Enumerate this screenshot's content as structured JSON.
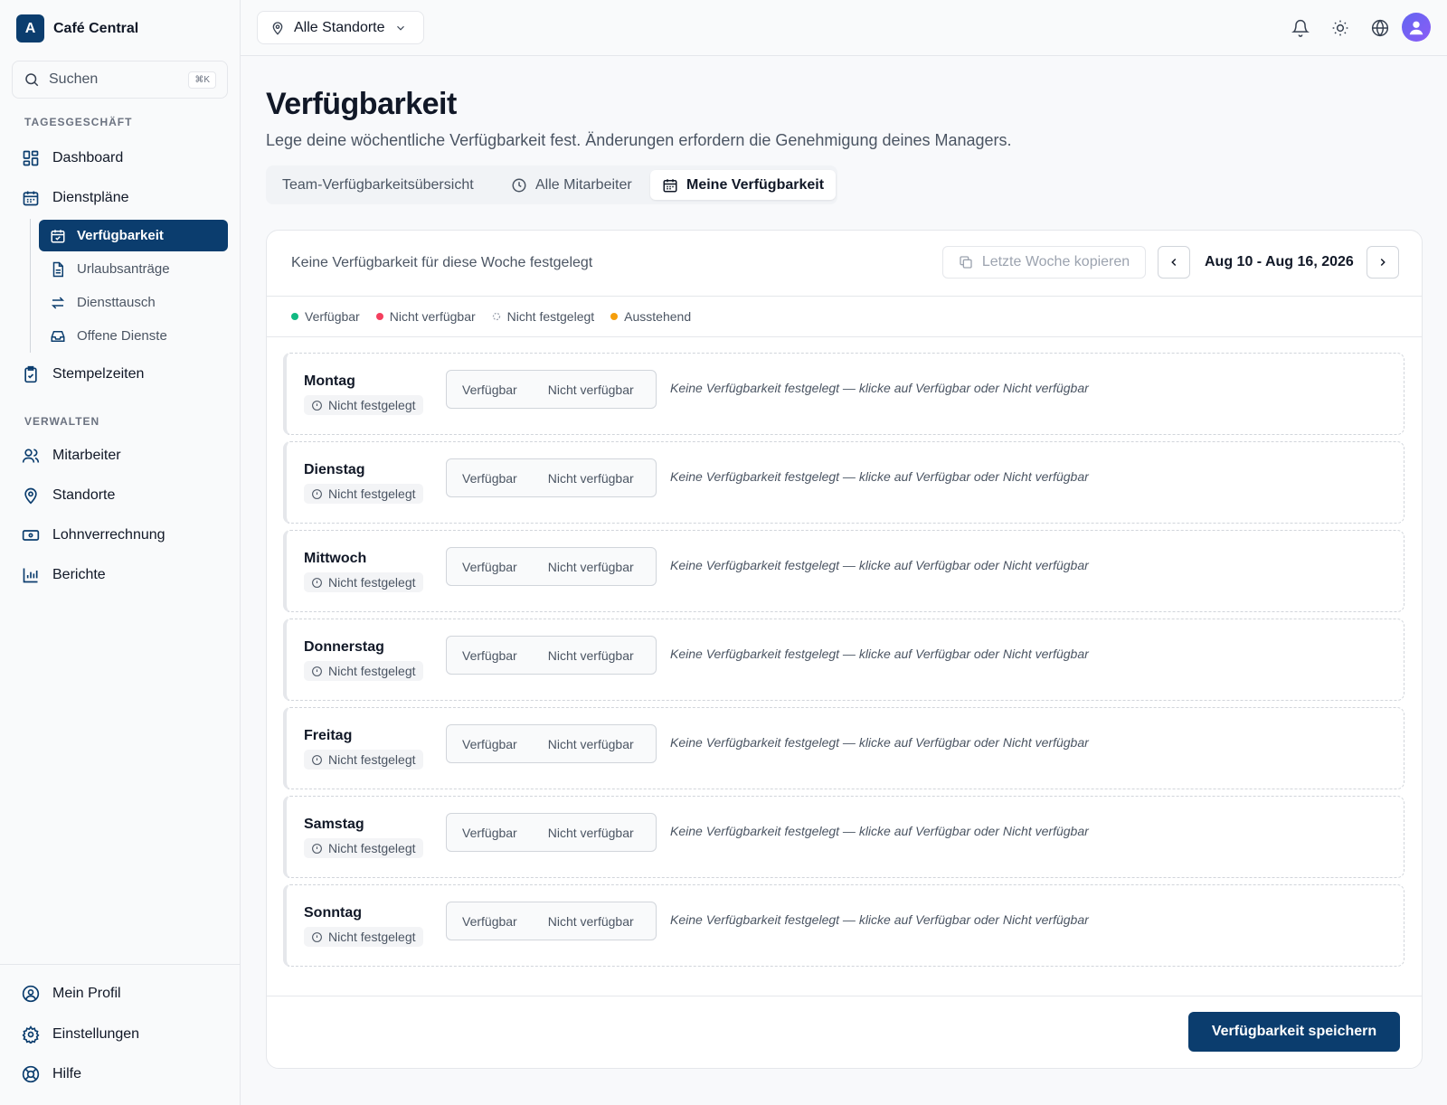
{
  "brand": {
    "logo_letter": "A",
    "name": "Café Central"
  },
  "search": {
    "label": "Suchen",
    "shortcut": "⌘K"
  },
  "sidebar": {
    "section_daily": "TAGESGESCHÄFT",
    "section_manage": "VERWALTEN",
    "dashboard": "Dashboard",
    "schedules": "Dienstpläne",
    "sub_items": [
      "Verfügbarkeit",
      "Urlaubsanträge",
      "Diensttausch",
      "Offene Dienste"
    ],
    "timeclock": "Stempelzeiten",
    "manage_items": [
      "Mitarbeiter",
      "Standorte",
      "Lohnverrechnung",
      "Berichte"
    ],
    "bottom_items": [
      "Mein Profil",
      "Einstellungen",
      "Hilfe"
    ]
  },
  "topbar": {
    "location": "Alle Standorte"
  },
  "page": {
    "title": "Verfügbarkeit",
    "subtitle": "Lege deine wöchentliche Verfügbarkeit fest. Änderungen erfordern die Genehmigung deines Managers."
  },
  "tabs": [
    "Team-Verfügbarkeitsübersicht",
    "Alle Mitarbeiter",
    "Meine Verfügbarkeit"
  ],
  "card": {
    "status": "Keine Verfügbarkeit für diese Woche festgelegt",
    "copy_label": "Letzte Woche kopieren",
    "week_range": "Aug 10 - Aug 16, 2026",
    "save_label": "Verfügbarkeit speichern"
  },
  "legend": [
    {
      "label": "Verfügbar",
      "color": "#10b981"
    },
    {
      "label": "Nicht verfügbar",
      "color": "#f43f5e"
    },
    {
      "label": "Nicht festgelegt",
      "color": "#9ca3af"
    },
    {
      "label": "Ausstehend",
      "color": "#f59e0b"
    }
  ],
  "days": [
    {
      "name": "Montag",
      "status": "Nicht festgelegt",
      "available": "Verfügbar",
      "unavailable": "Nicht verfügbar",
      "hint": "Keine Verfügbarkeit festgelegt — klicke auf Verfügbar oder Nicht verfügbar"
    },
    {
      "name": "Dienstag",
      "status": "Nicht festgelegt",
      "available": "Verfügbar",
      "unavailable": "Nicht verfügbar",
      "hint": "Keine Verfügbarkeit festgelegt — klicke auf Verfügbar oder Nicht verfügbar"
    },
    {
      "name": "Mittwoch",
      "status": "Nicht festgelegt",
      "available": "Verfügbar",
      "unavailable": "Nicht verfügbar",
      "hint": "Keine Verfügbarkeit festgelegt — klicke auf Verfügbar oder Nicht verfügbar"
    },
    {
      "name": "Donnerstag",
      "status": "Nicht festgelegt",
      "available": "Verfügbar",
      "unavailable": "Nicht verfügbar",
      "hint": "Keine Verfügbarkeit festgelegt — klicke auf Verfügbar oder Nicht verfügbar"
    },
    {
      "name": "Freitag",
      "status": "Nicht festgelegt",
      "available": "Verfügbar",
      "unavailable": "Nicht verfügbar",
      "hint": "Keine Verfügbarkeit festgelegt — klicke auf Verfügbar oder Nicht verfügbar"
    },
    {
      "name": "Samstag",
      "status": "Nicht festgelegt",
      "available": "Verfügbar",
      "unavailable": "Nicht verfügbar",
      "hint": "Keine Verfügbarkeit festgelegt — klicke auf Verfügbar oder Nicht verfügbar"
    },
    {
      "name": "Sonntag",
      "status": "Nicht festgelegt",
      "available": "Verfügbar",
      "unavailable": "Nicht verfügbar",
      "hint": "Keine Verfügbarkeit festgelegt — klicke auf Verfügbar oder Nicht verfügbar"
    }
  ],
  "colors": {
    "primary": "#0b3d6e"
  }
}
